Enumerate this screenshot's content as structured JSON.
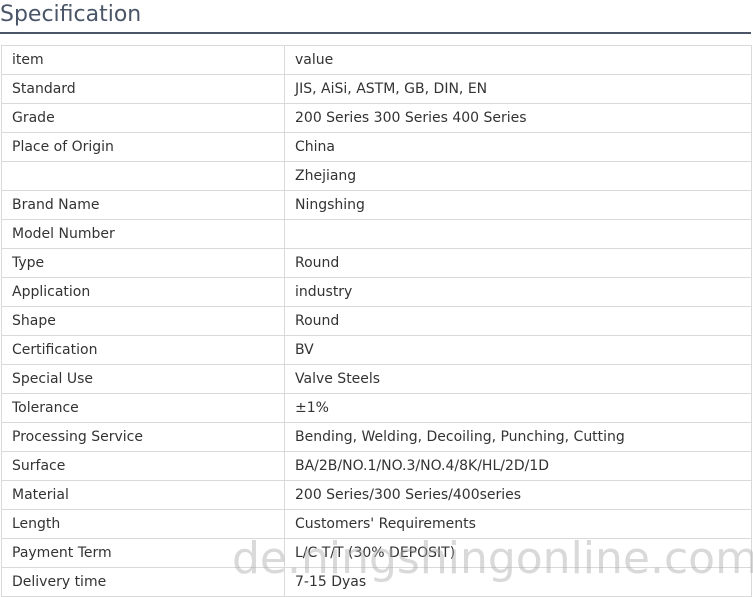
{
  "heading": "Specification",
  "table": {
    "rows": [
      {
        "item": "item",
        "value": "value"
      },
      {
        "item": "Standard",
        "value": "JIS, AiSi, ASTM, GB, DIN, EN"
      },
      {
        "item": "Grade",
        "value": "200 Series 300 Series 400 Series"
      },
      {
        "item": "Place of Origin",
        "value": "China"
      },
      {
        "item": "",
        "value": "Zhejiang"
      },
      {
        "item": "Brand Name",
        "value": "Ningshing"
      },
      {
        "item": "Model Number",
        "value": ""
      },
      {
        "item": "Type",
        "value": "Round"
      },
      {
        "item": "Application",
        "value": "industry"
      },
      {
        "item": "Shape",
        "value": "Round"
      },
      {
        "item": "Certification",
        "value": "BV"
      },
      {
        "item": "Special Use",
        "value": "Valve Steels"
      },
      {
        "item": "Tolerance",
        "value": "±1%"
      },
      {
        "item": "Processing Service",
        "value": "Bending, Welding, Decoiling, Punching, Cutting"
      },
      {
        "item": "Surface",
        "value": "BA/2B/NO.1/NO.3/NO.4/8K/HL/2D/1D"
      },
      {
        "item": "Material",
        "value": "200 Series/300 Series/400series"
      },
      {
        "item": "Length",
        "value": "Customers' Requirements"
      },
      {
        "item": "Payment Term",
        "value": "L/C T/T (30% DEPOSIT)"
      },
      {
        "item": "Delivery time",
        "value": "7-15 Dyas"
      }
    ]
  },
  "watermark": "de.ningshingonline.com"
}
